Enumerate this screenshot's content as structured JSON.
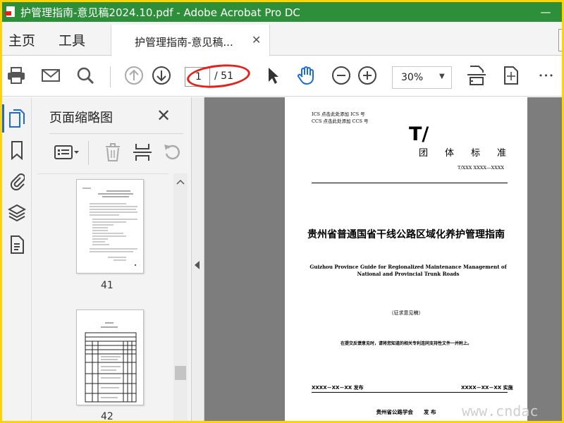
{
  "window": {
    "title": "护管理指南-意见稿2024.10.pdf - Adobe Acrobat Pro DC",
    "minimize_glyph": "—"
  },
  "menu": {
    "home": "主页",
    "tools": "工具"
  },
  "tab": {
    "label": "护管理指南-意见稿...",
    "close_glyph": "✕"
  },
  "toolbar": {
    "current_page": "1",
    "page_total": "/ 51",
    "zoom": "30%",
    "zoom_caret": "▼",
    "more_glyph": "•••"
  },
  "thumbnails_panel": {
    "title": "页面缩略图",
    "close_glyph": "✕",
    "pages": [
      {
        "label": "41"
      },
      {
        "label": "42"
      }
    ]
  },
  "document": {
    "ics_line": "ICS  点击此处添加 ICS 号",
    "ccs_line": "CCS  点击此处添加 CCS 号",
    "logo": "T/",
    "standard_type": "团体标准",
    "standard_number": "T/XXX XXXX—XXXX",
    "title_cn": "贵州省普通国省干线公路区域化养护管理指南",
    "title_en": "Guizhou Province Guide for Regionalized Maintenance Management of National and Provincial Trunk Roads",
    "draft_label": "（征求意见稿）",
    "notice": "在提交反馈意见时，请将您知道的相关专利连同支持性文件一并附上。",
    "publish_date": "XXXX－XX－XX 发布",
    "implement_date": "XXXX－XX－XX 实施",
    "publisher": "贵州省公路学会　　发 布"
  },
  "watermark": "www.cndac",
  "annotation_color": "#e0231c",
  "accent_color": "#1d6bd6",
  "titlebar_color": "#2d8f3a"
}
